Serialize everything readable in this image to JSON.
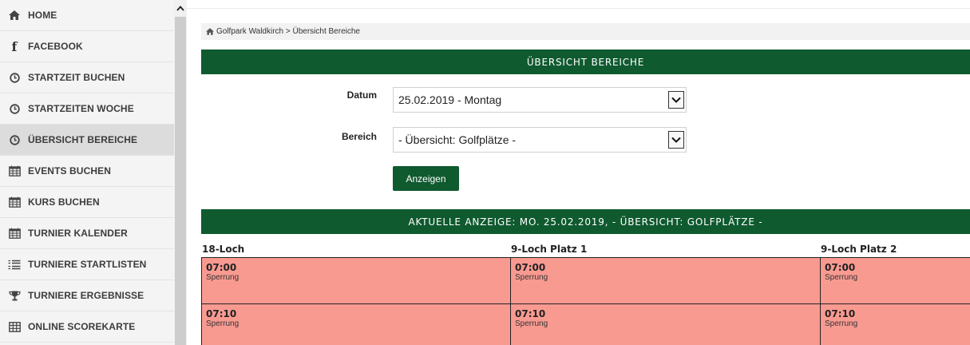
{
  "sidebar": {
    "items": [
      {
        "label": "HOME",
        "icon": "home-icon"
      },
      {
        "label": "FACEBOOK",
        "icon": "facebook-icon"
      },
      {
        "label": "STARTZEIT BUCHEN",
        "icon": "clock-icon"
      },
      {
        "label": "STARTZEITEN WOCHE",
        "icon": "clock-icon"
      },
      {
        "label": "ÜBERSICHT BEREICHE",
        "icon": "clock-icon",
        "active": true
      },
      {
        "label": "EVENTS BUCHEN",
        "icon": "calendar-icon"
      },
      {
        "label": "KURS BUCHEN",
        "icon": "calendar-icon"
      },
      {
        "label": "TURNIER KALENDER",
        "icon": "calendar-icon"
      },
      {
        "label": "TURNIERE STARTLISTEN",
        "icon": "list-icon"
      },
      {
        "label": "TURNIERE ERGEBNISSE",
        "icon": "trophy-icon"
      },
      {
        "label": "ONLINE SCOREKARTE",
        "icon": "table-icon"
      }
    ]
  },
  "breadcrumb": {
    "text": "Golfpark Waldkirch > Übersicht Bereiche"
  },
  "header": {
    "title": "ÜBERSICHT BEREICHE"
  },
  "form": {
    "datum_label": "Datum",
    "datum_value": "25.02.2019 - Montag",
    "bereich_label": "Bereich",
    "bereich_value": "- Übersicht: Golfplätze -",
    "submit_label": "Anzeigen"
  },
  "result": {
    "title": "AKTUELLE ANZEIGE: MO. 25.02.2019, - ÜBERSICHT: GOLFPLÄTZE -"
  },
  "table": {
    "columns": [
      "18-Loch",
      "9-Loch Platz 1",
      "9-Loch Platz 2"
    ],
    "rows": [
      [
        "07:00",
        "Sperrung"
      ],
      [
        "07:10",
        "Sperrung"
      ]
    ]
  },
  "colors": {
    "brand_green": "#0f5a2f",
    "blocked_cell": "#f99a91"
  }
}
